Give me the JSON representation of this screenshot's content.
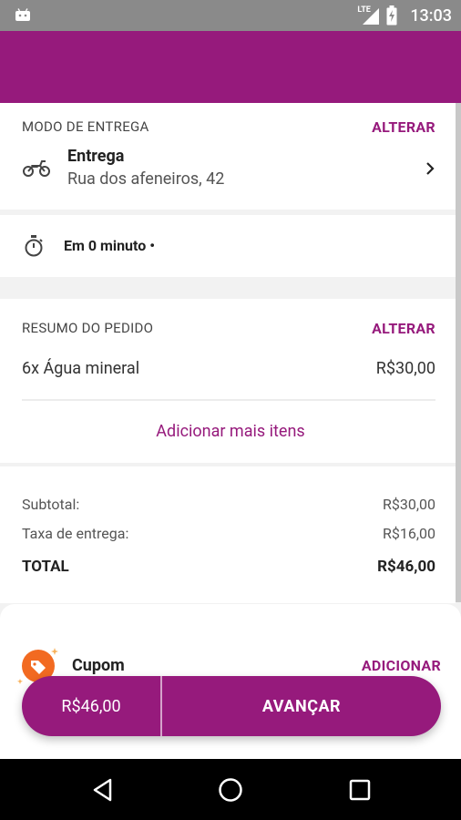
{
  "status_bar": {
    "network": "LTE",
    "time": "13:03"
  },
  "delivery": {
    "section_label": "MODO DE ENTREGA",
    "change_label": "ALTERAR",
    "mode_title": "Entrega",
    "address": "Rua dos afeneiros, 42",
    "eta": "Em 0 minuto •"
  },
  "summary": {
    "section_label": "RESUMO DO PEDIDO",
    "change_label": "ALTERAR",
    "items": [
      {
        "name": "6x Água mineral",
        "price": "R$30,00"
      }
    ],
    "add_more_label": "Adicionar mais itens"
  },
  "totals": {
    "subtotal_label": "Subtotal:",
    "subtotal_value": "R$30,00",
    "fee_label": "Taxa de entrega:",
    "fee_value": "R$16,00",
    "total_label": "TOTAL",
    "total_value": "R$46,00"
  },
  "coupon": {
    "label": "Cupom",
    "add_label": "ADICIONAR"
  },
  "cta": {
    "price": "R$46,00",
    "advance": "AVANÇAR"
  },
  "colors": {
    "brand": "#961a7c",
    "coupon_orange": "#f26a21"
  }
}
